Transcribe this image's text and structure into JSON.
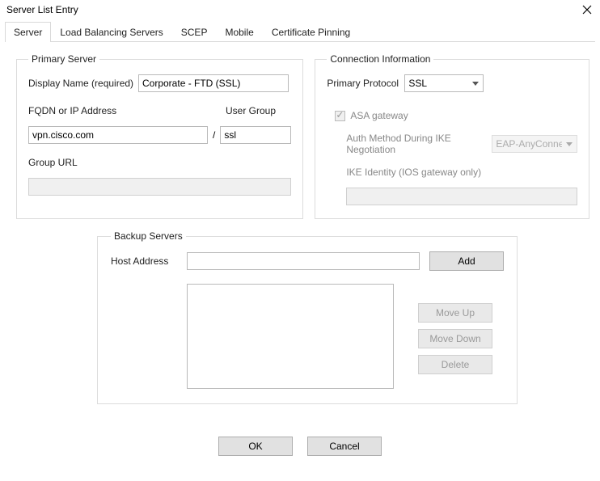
{
  "window": {
    "title": "Server List Entry"
  },
  "tabs": [
    "Server",
    "Load Balancing Servers",
    "SCEP",
    "Mobile",
    "Certificate Pinning"
  ],
  "primaryServer": {
    "legend": "Primary Server",
    "displayNameLabel": "Display Name (required)",
    "displayNameValue": "Corporate - FTD (SSL)",
    "fqdnLabel": "FQDN or IP Address",
    "fqdnValue": "vpn.cisco.com",
    "userGroupLabel": "User Group",
    "userGroupValue": "ssl",
    "groupUrlLabel": "Group URL",
    "groupUrlValue": ""
  },
  "connInfo": {
    "legend": "Connection Information",
    "primaryProtocolLabel": "Primary Protocol",
    "primaryProtocolValue": "SSL",
    "asaGatewayLabel": "ASA gateway",
    "authMethodLabel": "Auth Method During IKE Negotiation",
    "authMethodValue": "EAP-AnyConnect",
    "ikeIdentityLabel": "IKE Identity (IOS gateway only)",
    "ikeIdentityValue": ""
  },
  "backup": {
    "legend": "Backup Servers",
    "hostLabel": "Host Address",
    "hostValue": "",
    "addLabel": "Add",
    "moveUpLabel": "Move Up",
    "moveDownLabel": "Move Down",
    "deleteLabel": "Delete"
  },
  "buttons": {
    "ok": "OK",
    "cancel": "Cancel"
  }
}
